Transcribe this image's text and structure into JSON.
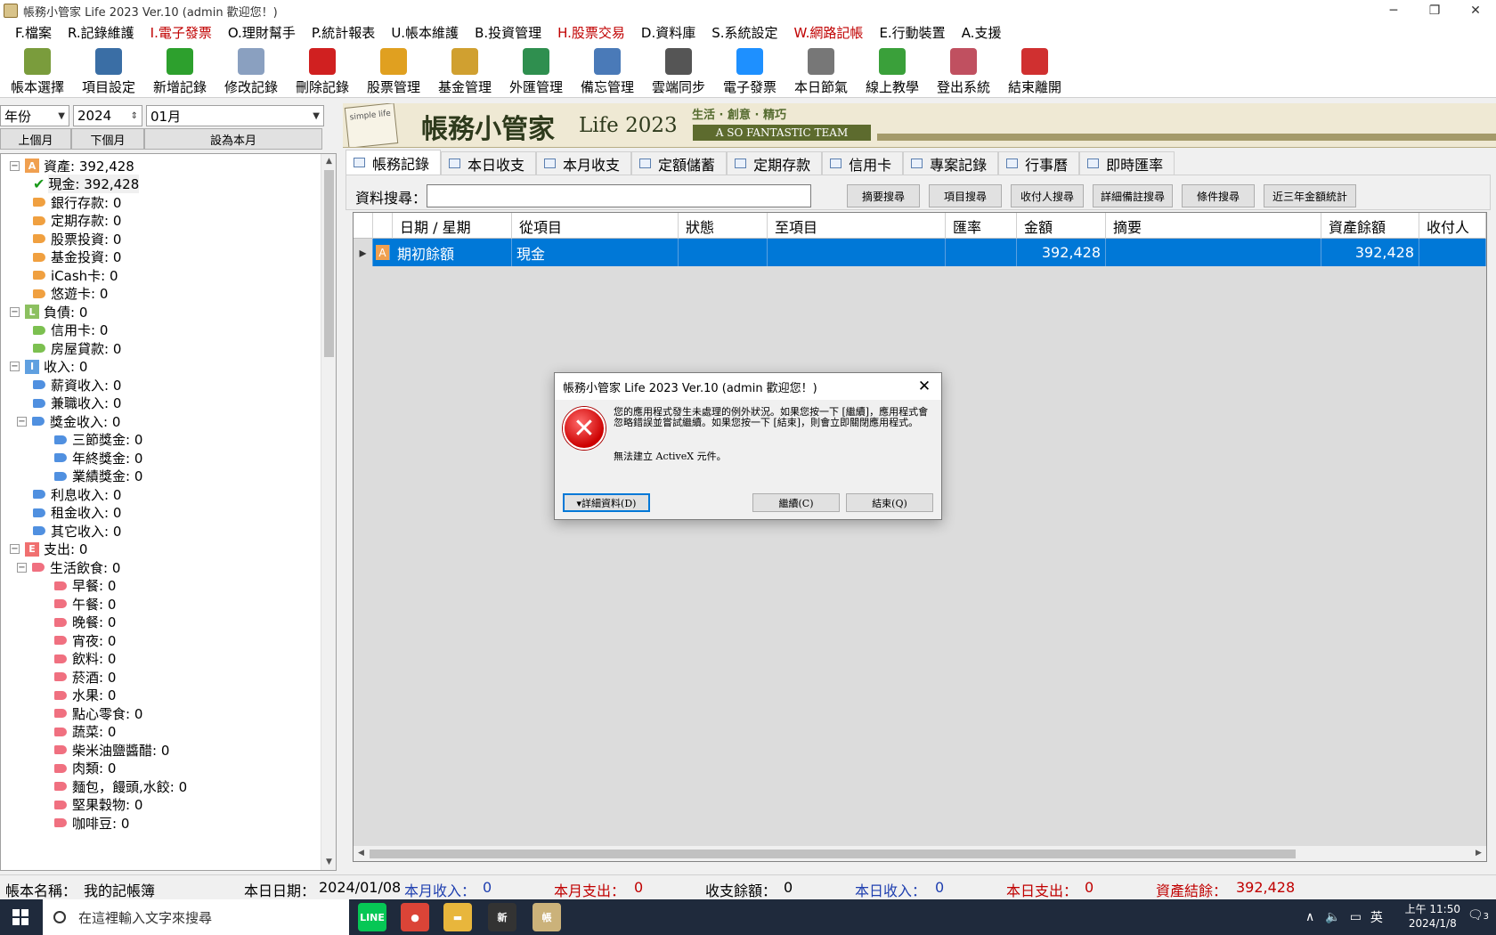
{
  "window": {
    "title": "帳務小管家 Life 2023 Ver.10 (admin 歡迎您！)"
  },
  "menu": [
    {
      "label": "F.檔案",
      "red": false
    },
    {
      "label": "R.記錄維護",
      "red": false
    },
    {
      "label": "I.電子發票",
      "red": true
    },
    {
      "label": "O.理財幫手",
      "red": false
    },
    {
      "label": "P.統計報表",
      "red": false
    },
    {
      "label": "U.帳本維護",
      "red": false
    },
    {
      "label": "B.投資管理",
      "red": false
    },
    {
      "label": "H.股票交易",
      "red": true
    },
    {
      "label": "D.資料庫",
      "red": false
    },
    {
      "label": "S.系統設定",
      "red": false
    },
    {
      "label": "W.網路記帳",
      "red": true
    },
    {
      "label": "E.行動裝置",
      "red": false
    },
    {
      "label": "A.支援",
      "red": false
    }
  ],
  "toolbar": [
    {
      "label": "帳本選擇",
      "icon": "books-icon",
      "color": "#7a9c3c"
    },
    {
      "label": "項目設定",
      "icon": "ledger-icon",
      "color": "#3a6ea5"
    },
    {
      "label": "新增記錄",
      "icon": "plus-icon",
      "color": "#2da02d"
    },
    {
      "label": "修改記錄",
      "icon": "eraser-icon",
      "color": "#8aa0c0"
    },
    {
      "label": "刪除記錄",
      "icon": "delete-icon",
      "color": "#d02020"
    },
    {
      "label": "股票管理",
      "icon": "stock-icon",
      "color": "#e0a020"
    },
    {
      "label": "基金管理",
      "icon": "fund-icon",
      "color": "#d0a030"
    },
    {
      "label": "外匯管理",
      "icon": "forex-icon",
      "color": "#2f8f4f"
    },
    {
      "label": "備忘管理",
      "icon": "monitor-icon",
      "color": "#4a7ab8"
    },
    {
      "label": "雲端同步",
      "icon": "laptop-icon",
      "color": "#555555"
    },
    {
      "label": "電子發票",
      "icon": "ie-icon",
      "color": "#1e90ff"
    },
    {
      "label": "本日節氣",
      "icon": "season-icon",
      "color": "#777777"
    },
    {
      "label": "線上教學",
      "icon": "help-icon",
      "color": "#3aa03a"
    },
    {
      "label": "登出系統",
      "icon": "users-icon",
      "color": "#c05060"
    },
    {
      "label": "結束離開",
      "icon": "exit-icon",
      "color": "#d03030"
    }
  ],
  "left": {
    "year_mode": "年份",
    "year": "2024",
    "month": "01月",
    "prev_label": "上個月",
    "next_label": "下個月",
    "current_label": "設為本月"
  },
  "tree": [
    {
      "label": "資產: 392,428",
      "level": 0,
      "kind": "cat",
      "letter": "A",
      "color": "#f0a050",
      "expanded": true
    },
    {
      "label": "現金: 392,428",
      "level": 1,
      "kind": "check",
      "selected": true
    },
    {
      "label": "銀行存款: 0",
      "level": 1,
      "kind": "tag",
      "color": "#f0a040"
    },
    {
      "label": "定期存款: 0",
      "level": 1,
      "kind": "tag",
      "color": "#f0a040"
    },
    {
      "label": "股票投資: 0",
      "level": 1,
      "kind": "tag",
      "color": "#f0a040"
    },
    {
      "label": "基金投資: 0",
      "level": 1,
      "kind": "tag",
      "color": "#f0a040"
    },
    {
      "label": "iCash卡: 0",
      "level": 1,
      "kind": "tag",
      "color": "#f0a040"
    },
    {
      "label": "悠遊卡: 0",
      "level": 1,
      "kind": "tag",
      "color": "#f0a040"
    },
    {
      "label": "負債: 0",
      "level": 0,
      "kind": "cat",
      "letter": "L",
      "color": "#8cc060",
      "expanded": true
    },
    {
      "label": "信用卡: 0",
      "level": 1,
      "kind": "tag",
      "color": "#7cc050"
    },
    {
      "label": "房屋貸款: 0",
      "level": 1,
      "kind": "tag",
      "color": "#7cc050"
    },
    {
      "label": "收入: 0",
      "level": 0,
      "kind": "cat",
      "letter": "I",
      "color": "#60a0e0",
      "expanded": true
    },
    {
      "label": "薪資收入: 0",
      "level": 1,
      "kind": "tag",
      "color": "#5090e0"
    },
    {
      "label": "兼職收入: 0",
      "level": 1,
      "kind": "tag",
      "color": "#5090e0"
    },
    {
      "label": "獎金收入: 0",
      "level": 1,
      "kind": "tag",
      "color": "#5090e0",
      "expanded": true
    },
    {
      "label": "三節獎金: 0",
      "level": 2,
      "kind": "tag",
      "color": "#5090e0"
    },
    {
      "label": "年終獎金: 0",
      "level": 2,
      "kind": "tag",
      "color": "#5090e0"
    },
    {
      "label": "業績獎金: 0",
      "level": 2,
      "kind": "tag",
      "color": "#5090e0"
    },
    {
      "label": "利息收入: 0",
      "level": 1,
      "kind": "tag",
      "color": "#5090e0"
    },
    {
      "label": "租金收入: 0",
      "level": 1,
      "kind": "tag",
      "color": "#5090e0"
    },
    {
      "label": "其它收入: 0",
      "level": 1,
      "kind": "tag",
      "color": "#5090e0"
    },
    {
      "label": "支出: 0",
      "level": 0,
      "kind": "cat",
      "letter": "E",
      "color": "#f07070",
      "expanded": true
    },
    {
      "label": "生活飲食: 0",
      "level": 1,
      "kind": "tag",
      "color": "#f07080",
      "expanded": true
    },
    {
      "label": "早餐: 0",
      "level": 2,
      "kind": "tag",
      "color": "#f07080"
    },
    {
      "label": "午餐: 0",
      "level": 2,
      "kind": "tag",
      "color": "#f07080"
    },
    {
      "label": "晚餐: 0",
      "level": 2,
      "kind": "tag",
      "color": "#f07080"
    },
    {
      "label": "宵夜: 0",
      "level": 2,
      "kind": "tag",
      "color": "#f07080"
    },
    {
      "label": "飲料: 0",
      "level": 2,
      "kind": "tag",
      "color": "#f07080"
    },
    {
      "label": "菸酒: 0",
      "level": 2,
      "kind": "tag",
      "color": "#f07080"
    },
    {
      "label": "水果: 0",
      "level": 2,
      "kind": "tag",
      "color": "#f07080"
    },
    {
      "label": "點心零食: 0",
      "level": 2,
      "kind": "tag",
      "color": "#f07080"
    },
    {
      "label": "蔬菜: 0",
      "level": 2,
      "kind": "tag",
      "color": "#f07080"
    },
    {
      "label": "柴米油鹽醬醋: 0",
      "level": 2,
      "kind": "tag",
      "color": "#f07080"
    },
    {
      "label": "肉類: 0",
      "level": 2,
      "kind": "tag",
      "color": "#f07080"
    },
    {
      "label": "麵包，饅頭,水餃: 0",
      "level": 2,
      "kind": "tag",
      "color": "#f07080"
    },
    {
      "label": "堅果穀物: 0",
      "level": 2,
      "kind": "tag",
      "color": "#f07080"
    },
    {
      "label": "咖啡豆: 0",
      "level": 2,
      "kind": "tag",
      "color": "#f07080"
    }
  ],
  "banner": {
    "title": "帳務小管家",
    "life": "Life 2023",
    "slogan": "生活 · 創意 · 精巧",
    "team": "A SO FANTASTIC TEAM",
    "book_text": "simple life"
  },
  "tabs": [
    {
      "label": "帳務記錄",
      "active": true
    },
    {
      "label": "本日收支",
      "active": false
    },
    {
      "label": "本月收支",
      "active": false
    },
    {
      "label": "定額儲蓄",
      "active": false
    },
    {
      "label": "定期存款",
      "active": false
    },
    {
      "label": "信用卡",
      "active": false
    },
    {
      "label": "專案記錄",
      "active": false
    },
    {
      "label": "行事曆",
      "active": false
    },
    {
      "label": "即時匯率",
      "active": false
    }
  ],
  "search": {
    "label": "資料搜尋：",
    "value": "",
    "buttons": [
      "摘要搜尋",
      "項目搜尋",
      "收付人搜尋",
      "詳細備註搜尋",
      "條件搜尋",
      "近三年金額統計"
    ]
  },
  "grid": {
    "columns": [
      "",
      "",
      "日期 / 星期",
      "從項目",
      "狀態",
      "至項目",
      "匯率",
      "金額",
      "摘要",
      "資產餘額",
      "收付人"
    ],
    "rows": [
      {
        "marker": "▸",
        "badge": "A",
        "date": "期初餘額",
        "from": "現金",
        "status": "",
        "to": "",
        "rate": "",
        "amount": "392,428",
        "summary": "",
        "balance": "392,428",
        "payee": ""
      }
    ]
  },
  "dialog": {
    "title": "帳務小管家 Life 2023 Ver.10 (admin 歡迎您！)",
    "message": "您的應用程式發生未處理的例外狀況。如果您按一下 [繼續]，應用程式會忽略錯誤並嘗試繼續。如果您按一下 [結束]，則會立即關閉應用程式。",
    "detail": "無法建立 ActiveX 元件。",
    "details_btn": "▾詳細資料(D)",
    "continue_btn": "繼續(C)",
    "quit_btn": "結束(Q)"
  },
  "status": {
    "book_label": "帳本名稱：",
    "book_name": "我的記帳簿",
    "date_label": "本日日期：",
    "date_value": "2024/01/08",
    "month_income_label": "本月收入：",
    "month_income": "0",
    "month_expense_label": "本月支出：",
    "month_expense": "0",
    "balance_label": "收支餘額：",
    "balance": "0",
    "day_income_label": "本日收入：",
    "day_income": "0",
    "day_expense_label": "本日支出：",
    "day_expense": "0",
    "asset_label": "資產結餘：",
    "asset": "392,428"
  },
  "taskbar": {
    "search_placeholder": "在這裡輸入文字來搜尋",
    "apps": [
      {
        "name": "line-icon",
        "label": "LINE",
        "color": "#06c755"
      },
      {
        "name": "chrome-icon",
        "label": "●",
        "color": "#db4437"
      },
      {
        "name": "folder-icon",
        "label": "▬",
        "color": "#e8b63c"
      },
      {
        "name": "news-icon",
        "label": "新",
        "color": "#333333"
      },
      {
        "name": "ledger-app-icon",
        "label": "帳",
        "color": "#cbb27a"
      }
    ],
    "ime": "英",
    "time": "上午 11:50",
    "date": "2024/1/8",
    "notif_count": "3"
  }
}
